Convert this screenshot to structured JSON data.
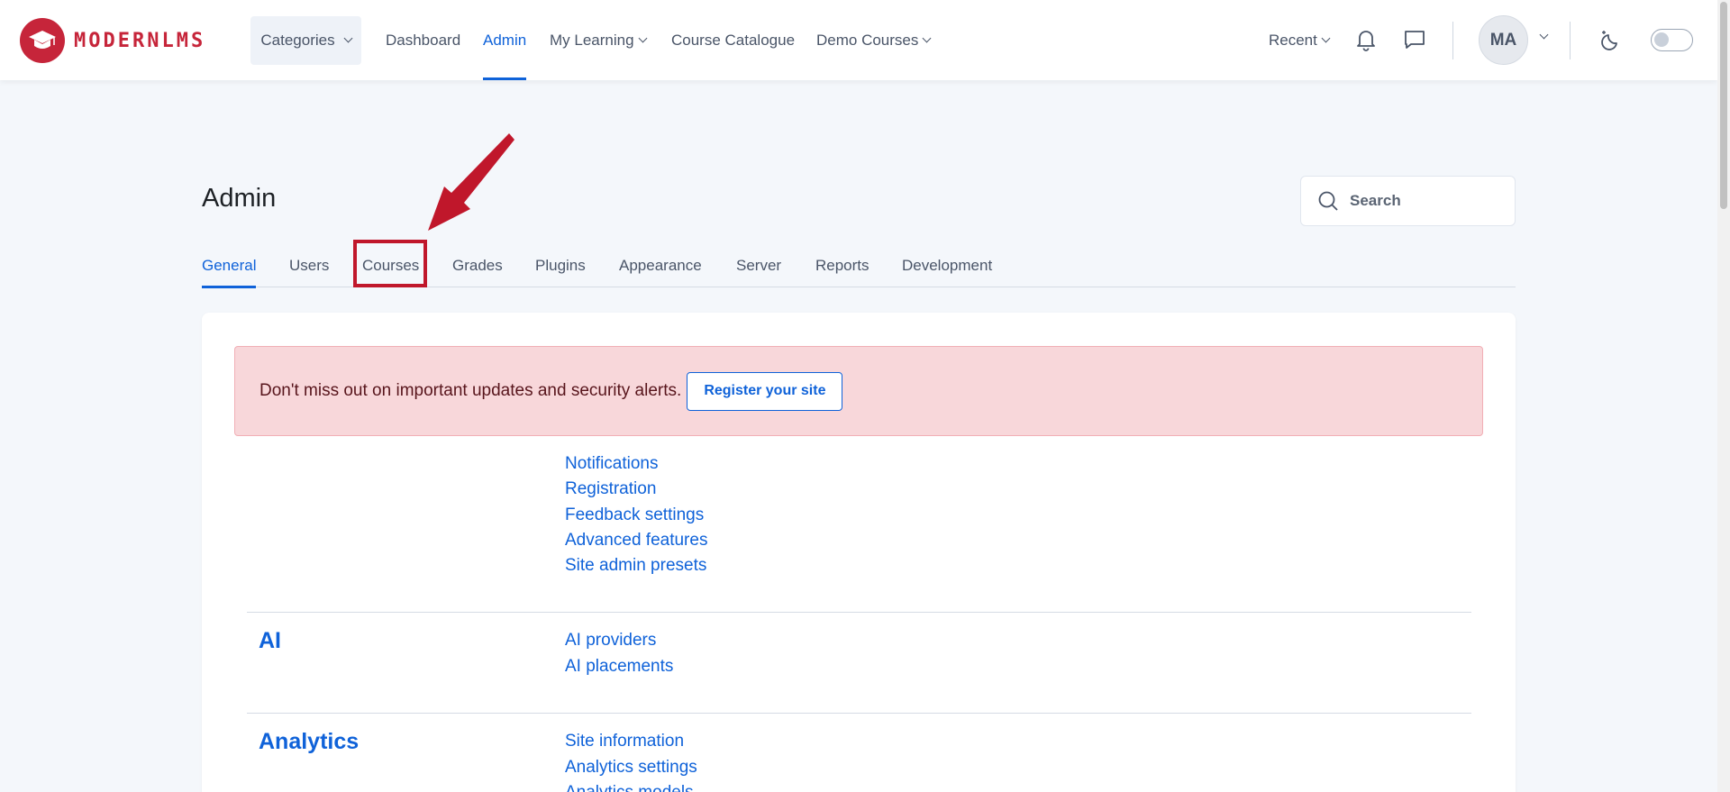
{
  "brand": {
    "name": "MODERNLMS"
  },
  "navbar": {
    "categories_label": "Categories",
    "items": [
      {
        "label": "Dashboard"
      },
      {
        "label": "Admin"
      },
      {
        "label": "My Learning"
      },
      {
        "label": "Course Catalogue"
      },
      {
        "label": "Demo Courses"
      }
    ],
    "recent_label": "Recent",
    "avatar_initials": "MA"
  },
  "page": {
    "title": "Admin",
    "search_label": "Search",
    "tabs": [
      {
        "label": "General"
      },
      {
        "label": "Users"
      },
      {
        "label": "Courses"
      },
      {
        "label": "Grades"
      },
      {
        "label": "Plugins"
      },
      {
        "label": "Appearance"
      },
      {
        "label": "Server"
      },
      {
        "label": "Reports"
      },
      {
        "label": "Development"
      }
    ]
  },
  "alert": {
    "text": "Don't miss out on important updates and security alerts.",
    "button_label": "Register your site"
  },
  "general_links": [
    "Notifications",
    "Registration",
    "Feedback settings",
    "Advanced features",
    "Site admin presets"
  ],
  "sections": [
    {
      "title": "AI",
      "links": [
        "AI providers",
        "AI placements"
      ]
    },
    {
      "title": "Analytics",
      "links": [
        "Site information",
        "Analytics settings",
        "Analytics models"
      ]
    }
  ],
  "colors": {
    "accent": "#0f62d9",
    "brand": "#c6253a",
    "highlight": "#c0172b"
  }
}
